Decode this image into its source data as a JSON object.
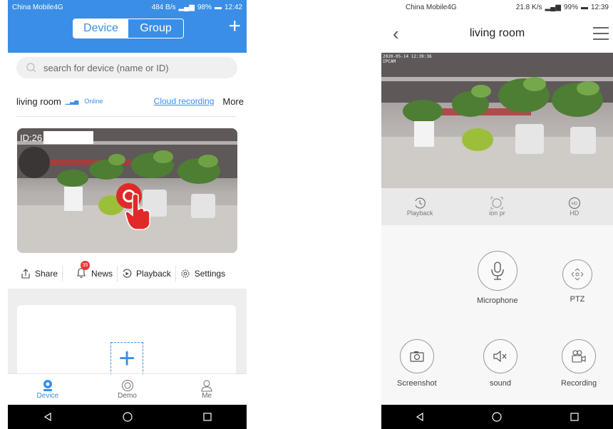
{
  "left": {
    "status": {
      "carrier": "China Mobile4G",
      "speed": "484 B/s",
      "battery": "98%",
      "time": "12:42"
    },
    "header": {
      "tab_device": "Device",
      "tab_group": "Group",
      "add_symbol": "+"
    },
    "search": {
      "placeholder": "search for device (name or ID)"
    },
    "device": {
      "name": "living room",
      "status": "Online",
      "cloud_link": "Cloud recording",
      "more": "More",
      "id_prefix": "ID:26"
    },
    "actions": {
      "share": "Share",
      "news": "News",
      "news_count": "35",
      "playback": "Playback",
      "settings": "Settings"
    },
    "tabs": {
      "device": "Device",
      "demo": "Demo",
      "me": "Me"
    },
    "colors": {
      "accent": "#3a8ee6",
      "play_button": "#e02a2a"
    }
  },
  "right": {
    "status": {
      "carrier": "China Mobile4G",
      "speed": "21.8 K/s",
      "battery": "99%",
      "time": "12:39"
    },
    "title": "living room",
    "video_timestamp": "2020-05-14 12:39:36",
    "video_label": "IPCAM",
    "quick": {
      "playback": "Playback",
      "pro": "ion  pr",
      "hd": "HD"
    },
    "controls": {
      "microphone": "Microphone",
      "ptz": "PTZ",
      "screenshot": "Screenshot",
      "sound": "sound",
      "recording": "Recording"
    }
  }
}
